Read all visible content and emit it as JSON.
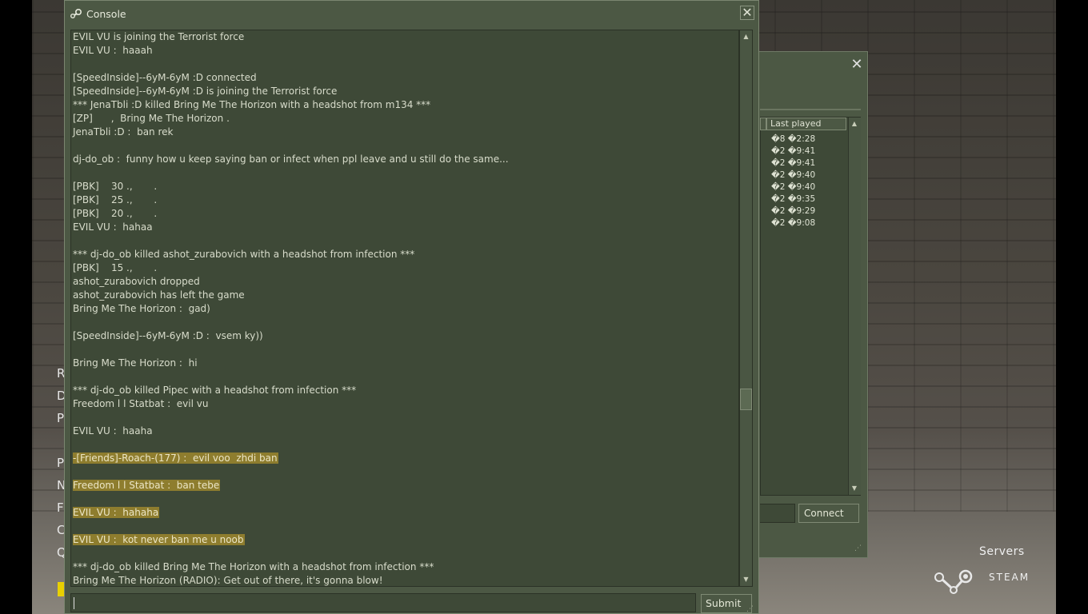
{
  "background": {
    "menu_letters": [
      "R",
      "D",
      "P",
      "P",
      "N",
      "F",
      "C",
      "Q"
    ]
  },
  "server_browser": {
    "close_label": "✕",
    "column_header": "Last played",
    "rows": [
      "�8 �2:28",
      "�2 �9:41",
      "�2 �9:41",
      "�2 �9:40",
      "�2 �9:40",
      "�2 �9:35",
      "�2 �9:29",
      "�2 �9:08"
    ],
    "connect_label": "Connect",
    "resize_grip": "⋰"
  },
  "branding": {
    "servers_label": "Servers",
    "steam_label": "STEAM"
  },
  "console": {
    "title": "Console",
    "close_label": "✕",
    "submit_label": "Submit",
    "input_value": "",
    "scroll_up": "▲",
    "scroll_down": "▼",
    "resize_grip": "⋰",
    "lines": [
      {
        "text": "EVIL VU is joining the Terrorist force",
        "hl": false
      },
      {
        "text": "EVIL VU :  haaah",
        "hl": false
      },
      {
        "text": "",
        "hl": false
      },
      {
        "text": "[SpeedInside]--6yM-6yM :D connected",
        "hl": false
      },
      {
        "text": "[SpeedInside]--6yM-6yM :D is joining the Terrorist force",
        "hl": false
      },
      {
        "text": "*** JenaTbli :D killed Bring Me The Horizon with a headshot from m134 ***",
        "hl": false
      },
      {
        "text": "[ZP]      ,  Bring Me The Horizon .",
        "hl": false
      },
      {
        "text": "JenaTbli :D :  ban rek",
        "hl": false
      },
      {
        "text": "",
        "hl": false
      },
      {
        "text": "dj-do_ob :  funny how u keep saying ban or infect when ppl leave and u still do the same...",
        "hl": false
      },
      {
        "text": "",
        "hl": false
      },
      {
        "text": "[PBK]    30 .,       .",
        "hl": false
      },
      {
        "text": "[PBK]    25 .,       .",
        "hl": false
      },
      {
        "text": "[PBK]    20 .,       .",
        "hl": false
      },
      {
        "text": "EVIL VU :  hahaa",
        "hl": false
      },
      {
        "text": "",
        "hl": false
      },
      {
        "text": "*** dj-do_ob killed ashot_zurabovich with a headshot from infection ***",
        "hl": false
      },
      {
        "text": "[PBK]    15 .,       .",
        "hl": false
      },
      {
        "text": "ashot_zurabovich dropped",
        "hl": false
      },
      {
        "text": "ashot_zurabovich has left the game",
        "hl": false
      },
      {
        "text": "Bring Me The Horizon :  gad)",
        "hl": false
      },
      {
        "text": "",
        "hl": false
      },
      {
        "text": "[SpeedInside]--6yM-6yM :D :  vsem ky))",
        "hl": false
      },
      {
        "text": "",
        "hl": false
      },
      {
        "text": "Bring Me The Horizon :  hi",
        "hl": false
      },
      {
        "text": "",
        "hl": false
      },
      {
        "text": "*** dj-do_ob killed Pipec with a headshot from infection ***",
        "hl": false
      },
      {
        "text": "Freedom l l Statbat :  evil vu",
        "hl": false
      },
      {
        "text": "",
        "hl": false
      },
      {
        "text": "EVIL VU :  haaha",
        "hl": false
      },
      {
        "text": "",
        "hl": false
      },
      {
        "text": "-[Friends]-Roach-(177) :  evil voo  zhdi ban",
        "hl": true
      },
      {
        "text": "",
        "hl": false
      },
      {
        "text": "Freedom l l Statbat :  ban tebe",
        "hl": true
      },
      {
        "text": "",
        "hl": false
      },
      {
        "text": "EVIL VU :  hahaha",
        "hl": true
      },
      {
        "text": "",
        "hl": false
      },
      {
        "text": "EVIL VU :  kot never ban me u noob",
        "hl": true
      },
      {
        "text": "",
        "hl": false
      },
      {
        "text": "*** dj-do_ob killed Bring Me The Horizon with a headshot from infection ***",
        "hl": false
      },
      {
        "text": "Bring Me The Horizon (RADIO): Get out of there, it's gonna blow!",
        "hl": false
      }
    ]
  }
}
